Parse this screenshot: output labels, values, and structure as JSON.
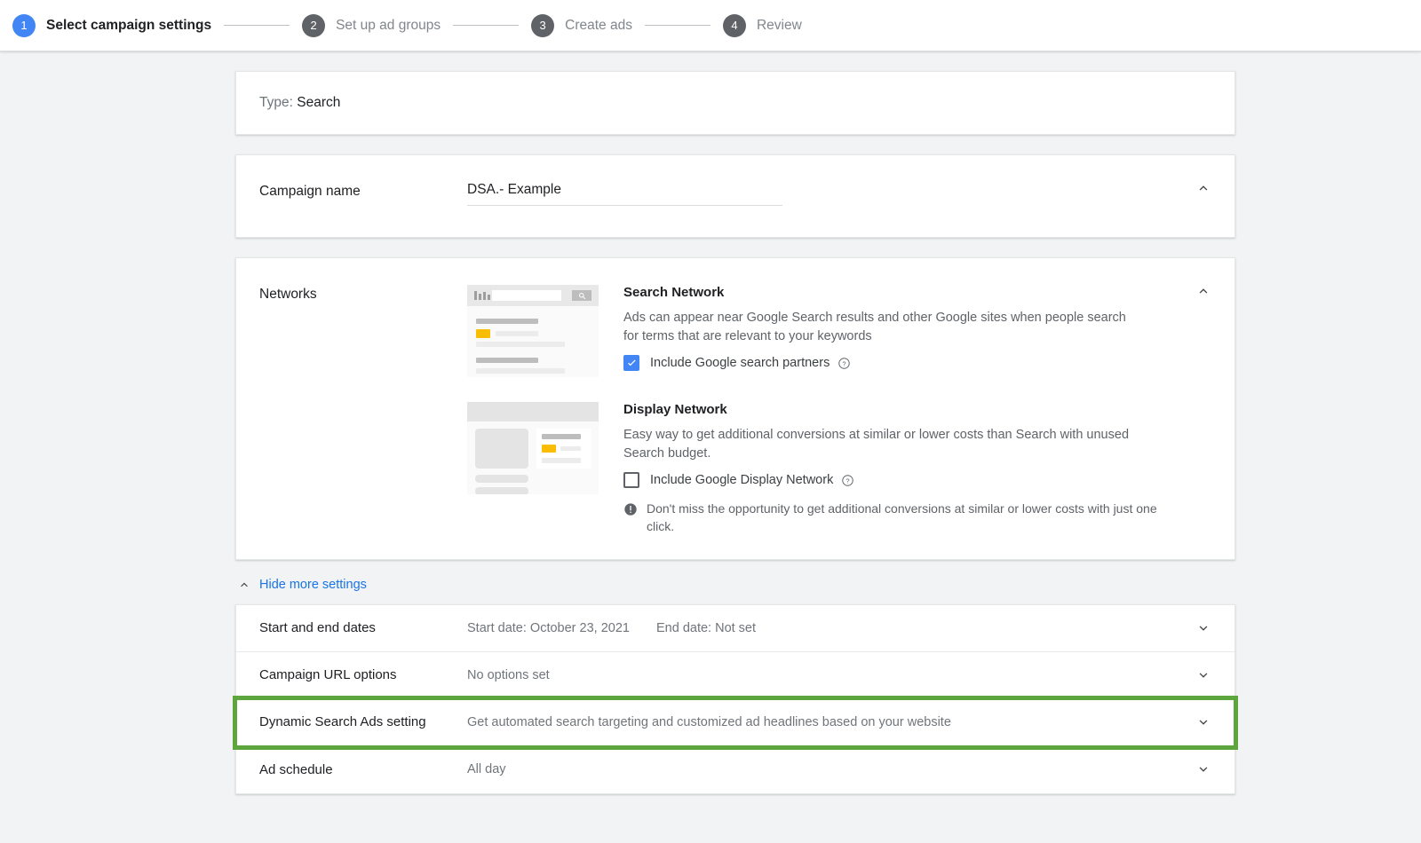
{
  "stepper": {
    "steps": [
      {
        "number": "1",
        "label": "Select campaign settings",
        "state": "active"
      },
      {
        "number": "2",
        "label": "Set up ad groups",
        "state": "inactive"
      },
      {
        "number": "3",
        "label": "Create ads",
        "state": "inactive"
      },
      {
        "number": "4",
        "label": "Review",
        "state": "inactive"
      }
    ]
  },
  "type_card": {
    "label": "Type:",
    "value": "Search"
  },
  "campaign_name": {
    "label": "Campaign name",
    "value": "DSA.- Example",
    "placeholder": "Campaign name"
  },
  "networks": {
    "label": "Networks",
    "search": {
      "title": "Search Network",
      "description": "Ads can appear near Google Search results and other Google sites when people search for terms that are relevant to your keywords",
      "checkbox_label": "Include Google search partners",
      "checked": true,
      "help_icon": "help-circle-icon"
    },
    "display": {
      "title": "Display Network",
      "description": "Easy way to get additional conversions at similar or lower costs than Search with unused Search budget.",
      "checkbox_label": "Include Google Display Network",
      "checked": false,
      "help_icon": "help-circle-icon",
      "note": "Don't miss the opportunity to get additional conversions at similar or lower costs with just one click.",
      "note_icon": "warning-circle-icon"
    }
  },
  "more_settings": {
    "label": "Hide more settings",
    "icon": "chevron-up-icon",
    "expanded": true
  },
  "settings_rows": [
    {
      "label": "Start and end dates",
      "value1": "Start date: October 23, 2021",
      "value2": "End date: Not set",
      "highlighted": false
    },
    {
      "label": "Campaign URL options",
      "value1": "No options set",
      "value2": "",
      "highlighted": false
    },
    {
      "label": "Dynamic Search Ads setting",
      "value1": "Get automated search targeting and customized ad headlines based on your website",
      "value2": "",
      "highlighted": true
    },
    {
      "label": "Ad schedule",
      "value1": "All day",
      "value2": "",
      "highlighted": false
    }
  ],
  "colors": {
    "accent_blue": "#4285f4",
    "link_blue": "#1a73e8",
    "step_inactive": "#5f6368",
    "highlight_green": "#5da53d",
    "ad_badge_yellow": "#fbbc04",
    "page_background": "#f1f3f4"
  }
}
